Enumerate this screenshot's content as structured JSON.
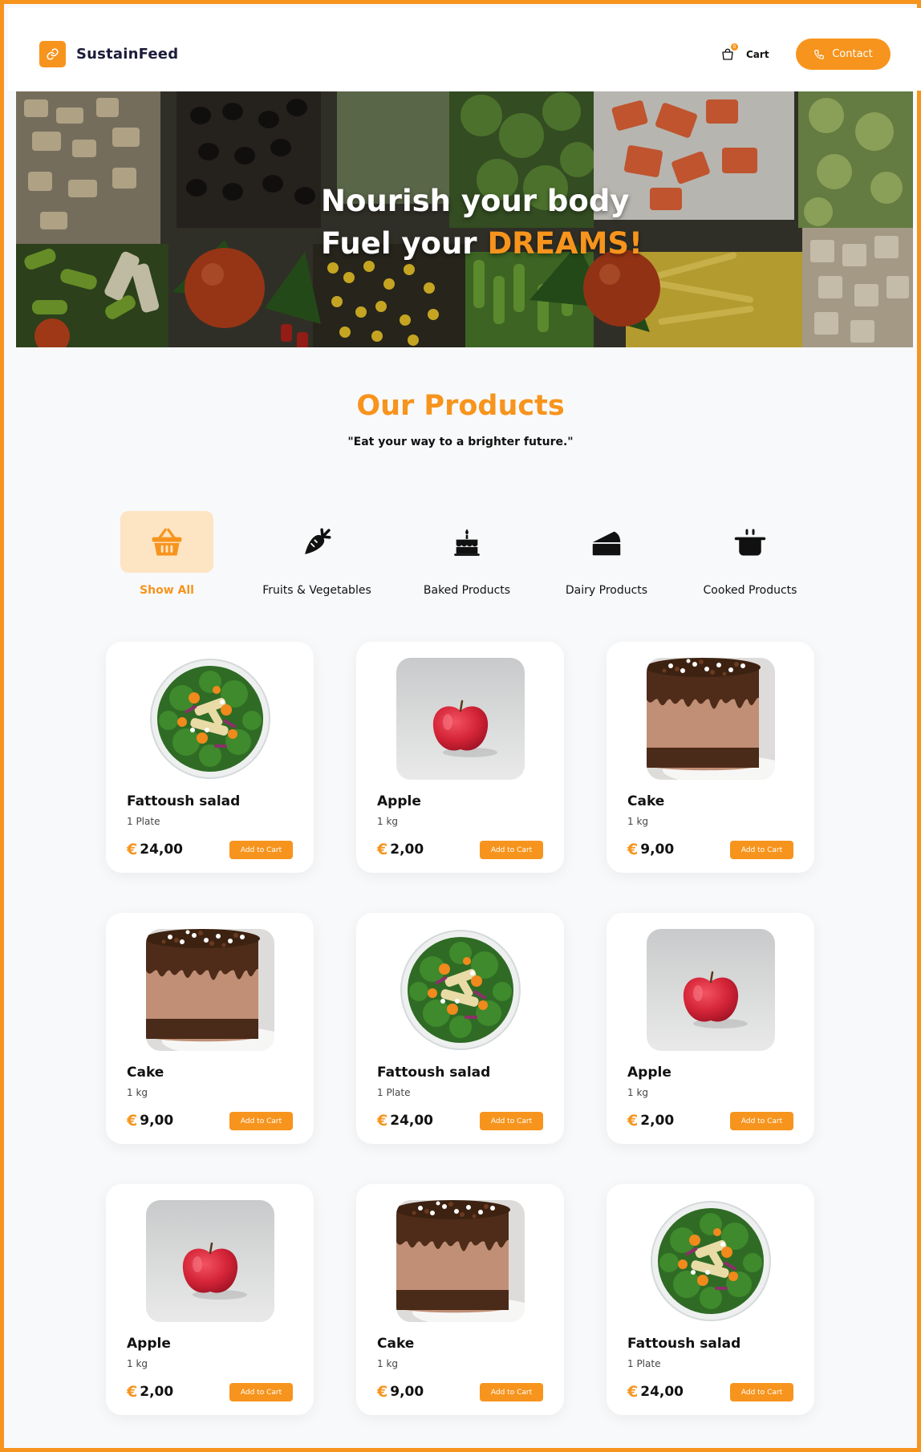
{
  "brand": {
    "name": "SustainFeed",
    "accent": "#f7941d"
  },
  "header": {
    "cart_label": "Cart",
    "cart_count": "0",
    "contact_label": "Contact"
  },
  "hero": {
    "line1": "Nourish your body",
    "line2_prefix": "Fuel your ",
    "line2_accent": "DREAMS!"
  },
  "products_section": {
    "title": "Our Products",
    "tagline": "\"Eat your way to a brighter future.\""
  },
  "categories": [
    {
      "label": "Show All",
      "icon": "basket-icon",
      "active": true
    },
    {
      "label": "Fruits & Vegetables",
      "icon": "carrot-icon",
      "active": false
    },
    {
      "label": "Baked Products",
      "icon": "birthday-cake-icon",
      "active": false
    },
    {
      "label": "Dairy Products",
      "icon": "cheese-icon",
      "active": false
    },
    {
      "label": "Cooked Products",
      "icon": "cooking-pot-icon",
      "active": false
    }
  ],
  "products": [
    {
      "name": "Fattoush salad",
      "qty": "1 Plate",
      "currency": "€",
      "price": "24,00",
      "button": "Add to Cart",
      "image": "salad"
    },
    {
      "name": "Apple",
      "qty": "1 kg",
      "currency": "€",
      "price": "2,00",
      "button": "Add to Cart",
      "image": "apple"
    },
    {
      "name": "Cake",
      "qty": "1 kg",
      "currency": "€",
      "price": "9,00",
      "button": "Add to Cart",
      "image": "cake"
    },
    {
      "name": "Cake",
      "qty": "1 kg",
      "currency": "€",
      "price": "9,00",
      "button": "Add to Cart",
      "image": "cake"
    },
    {
      "name": "Fattoush salad",
      "qty": "1 Plate",
      "currency": "€",
      "price": "24,00",
      "button": "Add to Cart",
      "image": "salad"
    },
    {
      "name": "Apple",
      "qty": "1 kg",
      "currency": "€",
      "price": "2,00",
      "button": "Add to Cart",
      "image": "apple"
    },
    {
      "name": "Apple",
      "qty": "1 kg",
      "currency": "€",
      "price": "2,00",
      "button": "Add to Cart",
      "image": "apple"
    },
    {
      "name": "Cake",
      "qty": "1 kg",
      "currency": "€",
      "price": "9,00",
      "button": "Add to Cart",
      "image": "cake"
    },
    {
      "name": "Fattoush salad",
      "qty": "1 Plate",
      "currency": "€",
      "price": "24,00",
      "button": "Add to Cart",
      "image": "salad"
    }
  ]
}
